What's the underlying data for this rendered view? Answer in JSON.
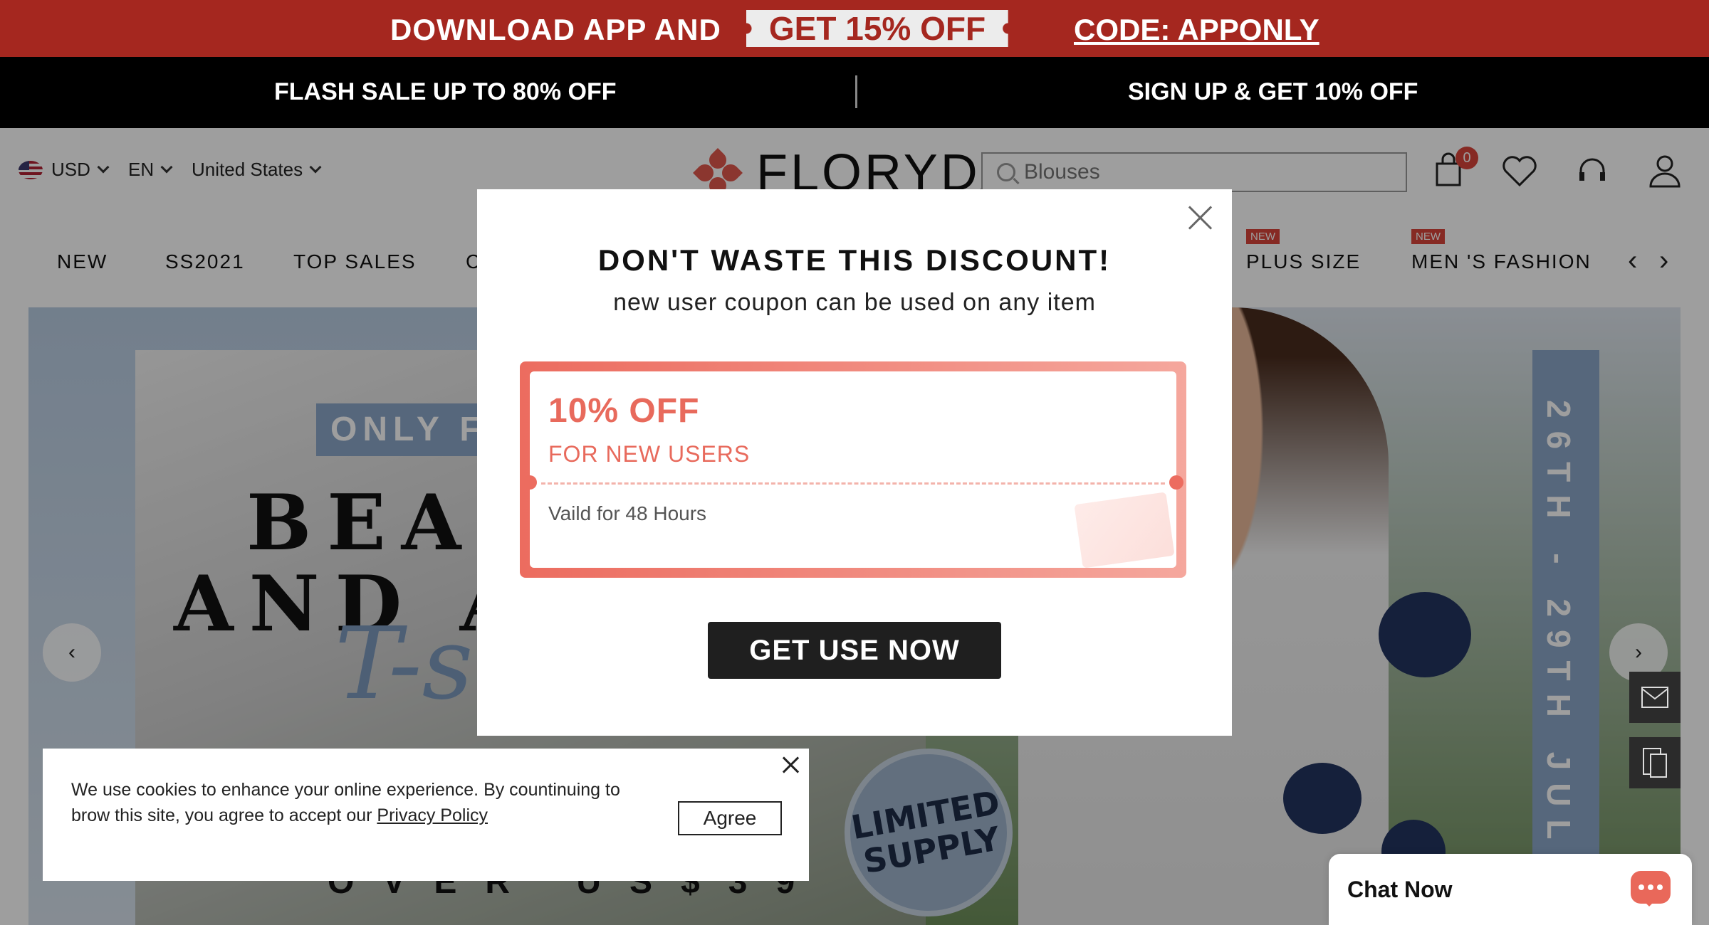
{
  "promo": {
    "left_text": "DOWNLOAD APP AND",
    "ticket_text": "GET 15% OFF",
    "code_text": "CODE: APPONLY"
  },
  "flash": {
    "left": "FLASH SALE UP TO 80% OFF",
    "right": "SIGN UP & GET 10% OFF"
  },
  "header": {
    "currency": "USD",
    "language": "EN",
    "country": "United States",
    "logo_text": "FLORYDA",
    "search_placeholder": "Blouses",
    "cart_count": "0",
    "icons": [
      "cart-icon",
      "heart-icon",
      "headset-icon",
      "user-icon"
    ]
  },
  "nav": {
    "items": [
      "NEW",
      "SS2021",
      "TOP SALES",
      "C",
      "PLUS SIZE",
      "MEN 'S FASHION"
    ],
    "new_tag": "NEW"
  },
  "banner": {
    "only_text": "ONLY FO",
    "line1": "BEAU",
    "line2": "AND A",
    "script": "T-s",
    "over_text": "OVER US$39",
    "limited": "LIMITED\nSUPPLY",
    "vertical": "26TH - 29TH JUL",
    "prev": "‹",
    "next": "›"
  },
  "modal": {
    "title": "DON'T WASTE THIS DISCOUNT!",
    "subtitle": "new user coupon can be used on any item",
    "coupon_value": "10% OFF",
    "coupon_for": "FOR NEW USERS",
    "coupon_valid": "Vaild for 48 Hours",
    "button": "GET USE NOW"
  },
  "cookie": {
    "text": "We use cookies to enhance your online experience. By countinuing to brow this site, you agree to accept our ",
    "link": "Privacy Policy",
    "agree": "Agree"
  },
  "chat": {
    "label": "Chat Now"
  },
  "colors": {
    "promo_bg": "#a5271f",
    "accent": "#e86a5c",
    "dark": "#1f1f1f"
  }
}
